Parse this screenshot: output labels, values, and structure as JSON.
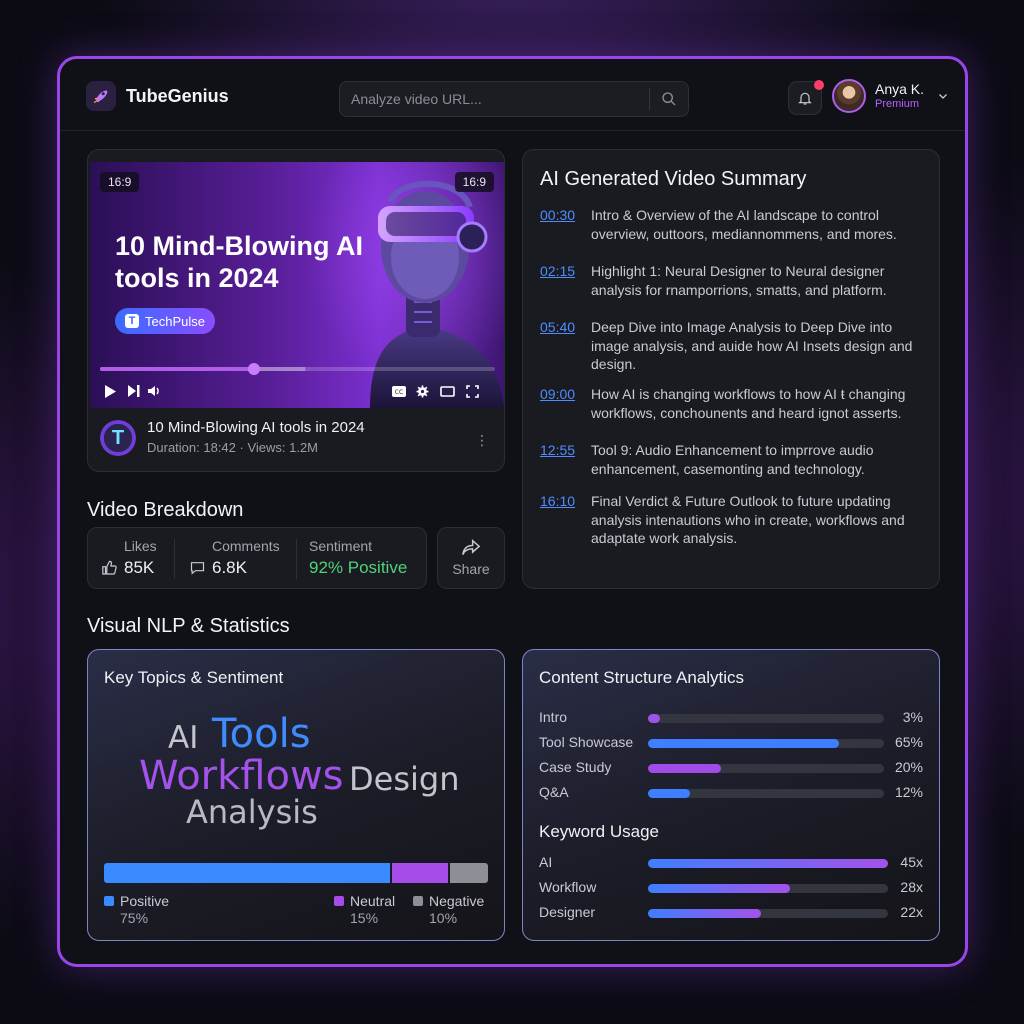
{
  "app": {
    "name": "TubeGenius",
    "logo_icon": "rocket-icon"
  },
  "search": {
    "placeholder": "Analyze video URL..."
  },
  "user": {
    "name": "Anya K.",
    "tier": "Premium"
  },
  "video": {
    "aspect_left": "16:9",
    "aspect_right": "16:9",
    "thumbnail_title": "10 Mind-Blowing AI tools in 2024",
    "channel": "TechPulse",
    "progress": 0.39,
    "buffered": 0.52,
    "title": "10 Mind-Blowing AI tools in 2024",
    "meta": "Duration: 18:42 · Views: 1.2M"
  },
  "summary": {
    "title": "AI Generated Video Summary",
    "items": [
      {
        "time": "00:30",
        "text": "Intro & Overview of the AI landscape to control overview, outtoors, mediannommens, and mores."
      },
      {
        "time": "02:15",
        "text": "Highlight 1: Neural Designer to Neural designer analysis for rnamporrions, smatts, and platform."
      },
      {
        "time": "05:40",
        "text": "Deep Dive into Image Analysis to Deep Dive into image analysis, and auide how AI Insets design and design."
      },
      {
        "time": "09:00",
        "text": "How AI is changing workflows to how AI ŧ changing workflows, conchounents and heard ignot asserts."
      },
      {
        "time": "12:55",
        "text": "Tool 9: Audio Enhancement to imprrove audio enhancement, casemonting and technology."
      },
      {
        "time": "16:10",
        "text": "Final Verdict & Future Outlook to future updating analysis intenautions who in create, workflows and adaptate work analysis."
      }
    ]
  },
  "breakdown": {
    "title": "Video Breakdown",
    "likes_label": "Likes",
    "likes_value": "85K",
    "comments_label": "Comments",
    "comments_value": "6.8K",
    "sentiment_label": "Sentiment",
    "sentiment_value": "92% Positive",
    "share_label": "Share"
  },
  "nlp": {
    "title": "Visual NLP & Statistics",
    "topics": {
      "title": "Key Topics & Sentiment",
      "words": [
        "AI",
        "Tools",
        "Workflows",
        "Design",
        "Analysis"
      ],
      "positive_label": "Positive",
      "positive_pct": "75%",
      "positive_value": 75,
      "neutral_label": "Neutral",
      "neutral_pct": "15%",
      "neutral_value": 15,
      "negative_label": "Negative",
      "negative_pct": "10%",
      "negative_value": 10,
      "colors": {
        "positive": "#3a8bff",
        "neutral": "#a64ce8",
        "negative": "#8e8f96"
      }
    },
    "structure": {
      "title": "Content Structure Analytics",
      "rows": [
        {
          "label": "Intro",
          "value": "3%",
          "fraction": 0.05,
          "color": "#9b56e8"
        },
        {
          "label": "Tool Showcase",
          "value": "65%",
          "fraction": 0.81,
          "color": "#3f7fff"
        },
        {
          "label": "Case Study",
          "value": "20%",
          "fraction": 0.31,
          "color": "#a14ce8"
        },
        {
          "label": "Q&A",
          "value": "12%",
          "fraction": 0.18,
          "color": "#3f7fff"
        }
      ],
      "keyword_title": "Keyword Usage",
      "keywords": [
        {
          "label": "AI",
          "value": "45x",
          "fraction": 1.0
        },
        {
          "label": "Workflow",
          "value": "28x",
          "fraction": 0.59
        },
        {
          "label": "Designer",
          "value": "22x",
          "fraction": 0.47
        }
      ]
    }
  }
}
